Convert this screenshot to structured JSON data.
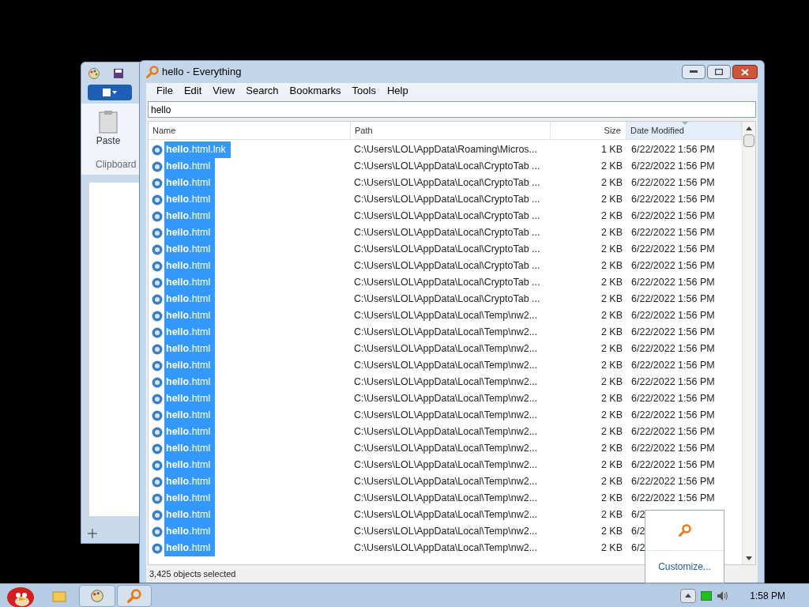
{
  "paint_window": {
    "ribbon_buttons": [
      "Paste"
    ],
    "group_label": "Clipboard"
  },
  "window": {
    "title": "hello - Everything"
  },
  "menu": [
    "File",
    "Edit",
    "View",
    "Search",
    "Bookmarks",
    "Tools",
    "Help"
  ],
  "search": {
    "value": "hello"
  },
  "table": {
    "columns": [
      {
        "label": "Name",
        "sorted": false
      },
      {
        "label": "Path",
        "sorted": false
      },
      {
        "label": "Size",
        "sorted": false
      },
      {
        "label": "Date Modified",
        "sorted": true
      }
    ],
    "rows": [
      {
        "name": "**hello**.html.lnk",
        "path": "C:\\Users\\LOL\\AppData\\Roaming\\Micros...",
        "size": "1 KB",
        "date": "6/22/2022 1:56 PM",
        "selected": true
      },
      {
        "name": "**hello**.html",
        "path": "C:\\Users\\LOL\\AppData\\Local\\CryptoTab ...",
        "size": "2 KB",
        "date": "6/22/2022 1:56 PM",
        "selected": true
      },
      {
        "name": "**hello**.html",
        "path": "C:\\Users\\LOL\\AppData\\Local\\CryptoTab ...",
        "size": "2 KB",
        "date": "6/22/2022 1:56 PM",
        "selected": true
      },
      {
        "name": "**hello**.html",
        "path": "C:\\Users\\LOL\\AppData\\Local\\CryptoTab ...",
        "size": "2 KB",
        "date": "6/22/2022 1:56 PM",
        "selected": true
      },
      {
        "name": "**hello**.html",
        "path": "C:\\Users\\LOL\\AppData\\Local\\CryptoTab ...",
        "size": "2 KB",
        "date": "6/22/2022 1:56 PM",
        "selected": true
      },
      {
        "name": "**hello**.html",
        "path": "C:\\Users\\LOL\\AppData\\Local\\CryptoTab ...",
        "size": "2 KB",
        "date": "6/22/2022 1:56 PM",
        "selected": true
      },
      {
        "name": "**hello**.html",
        "path": "C:\\Users\\LOL\\AppData\\Local\\CryptoTab ...",
        "size": "2 KB",
        "date": "6/22/2022 1:56 PM",
        "selected": true
      },
      {
        "name": "**hello**.html",
        "path": "C:\\Users\\LOL\\AppData\\Local\\CryptoTab ...",
        "size": "2 KB",
        "date": "6/22/2022 1:56 PM",
        "selected": true
      },
      {
        "name": "**hello**.html",
        "path": "C:\\Users\\LOL\\AppData\\Local\\CryptoTab ...",
        "size": "2 KB",
        "date": "6/22/2022 1:56 PM",
        "selected": true
      },
      {
        "name": "**hello**.html",
        "path": "C:\\Users\\LOL\\AppData\\Local\\CryptoTab ...",
        "size": "2 KB",
        "date": "6/22/2022 1:56 PM",
        "selected": true
      },
      {
        "name": "**hello**.html",
        "path": "C:\\Users\\LOL\\AppData\\Local\\Temp\\nw2...",
        "size": "2 KB",
        "date": "6/22/2022 1:56 PM",
        "selected": true
      },
      {
        "name": "**hello**.html",
        "path": "C:\\Users\\LOL\\AppData\\Local\\Temp\\nw2...",
        "size": "2 KB",
        "date": "6/22/2022 1:56 PM",
        "selected": true
      },
      {
        "name": "**hello**.html",
        "path": "C:\\Users\\LOL\\AppData\\Local\\Temp\\nw2...",
        "size": "2 KB",
        "date": "6/22/2022 1:56 PM",
        "selected": true
      },
      {
        "name": "**hello**.html",
        "path": "C:\\Users\\LOL\\AppData\\Local\\Temp\\nw2...",
        "size": "2 KB",
        "date": "6/22/2022 1:56 PM",
        "selected": true
      },
      {
        "name": "**hello**.html",
        "path": "C:\\Users\\LOL\\AppData\\Local\\Temp\\nw2...",
        "size": "2 KB",
        "date": "6/22/2022 1:56 PM",
        "selected": true
      },
      {
        "name": "**hello**.html",
        "path": "C:\\Users\\LOL\\AppData\\Local\\Temp\\nw2...",
        "size": "2 KB",
        "date": "6/22/2022 1:56 PM",
        "selected": true
      },
      {
        "name": "**hello**.html",
        "path": "C:\\Users\\LOL\\AppData\\Local\\Temp\\nw2...",
        "size": "2 KB",
        "date": "6/22/2022 1:56 PM",
        "selected": true
      },
      {
        "name": "**hello**.html",
        "path": "C:\\Users\\LOL\\AppData\\Local\\Temp\\nw2...",
        "size": "2 KB",
        "date": "6/22/2022 1:56 PM",
        "selected": true
      },
      {
        "name": "**hello**.html",
        "path": "C:\\Users\\LOL\\AppData\\Local\\Temp\\nw2...",
        "size": "2 KB",
        "date": "6/22/2022 1:56 PM",
        "selected": true
      },
      {
        "name": "**hello**.html",
        "path": "C:\\Users\\LOL\\AppData\\Local\\Temp\\nw2...",
        "size": "2 KB",
        "date": "6/22/2022 1:56 PM",
        "selected": true
      },
      {
        "name": "**hello**.html",
        "path": "C:\\Users\\LOL\\AppData\\Local\\Temp\\nw2...",
        "size": "2 KB",
        "date": "6/22/2022 1:56 PM",
        "selected": true
      },
      {
        "name": "**hello**.html",
        "path": "C:\\Users\\LOL\\AppData\\Local\\Temp\\nw2...",
        "size": "2 KB",
        "date": "6/22/2022 1:56 PM",
        "selected": true
      },
      {
        "name": "**hello**.html",
        "path": "C:\\Users\\LOL\\AppData\\Local\\Temp\\nw2...",
        "size": "2 KB",
        "date": "6/2",
        "selected": true
      },
      {
        "name": "**hello**.html",
        "path": "C:\\Users\\LOL\\AppData\\Local\\Temp\\nw2...",
        "size": "2 KB",
        "date": "6/2",
        "selected": true
      },
      {
        "name": "**hello**.html",
        "path": "C:\\Users\\LOL\\AppData\\Local\\Temp\\nw2...",
        "size": "2 KB",
        "date": "6/2",
        "selected": true
      }
    ]
  },
  "status_bar": "3,425 objects selected",
  "tray_popup": {
    "link": "Customize..."
  },
  "taskbar": {
    "clock": "1:58 PM"
  }
}
